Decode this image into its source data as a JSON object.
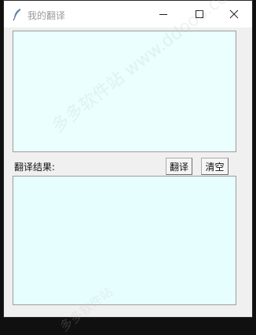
{
  "window": {
    "title": "我的翻译",
    "icon": "feather-icon",
    "controls": [
      "minimize-icon",
      "maximize-icon",
      "close-icon"
    ]
  },
  "main": {
    "result_label": "翻译结果:",
    "translate_button": "翻译",
    "clear_button": "清空",
    "input_value": "",
    "result_value": ""
  },
  "watermark": {
    "text": "多多软件站 www.ddooo.com",
    "text_bottom": "多多软件站"
  },
  "colors": {
    "textbox_bg": "#eafffe",
    "window_bg": "#f0f0f0"
  }
}
